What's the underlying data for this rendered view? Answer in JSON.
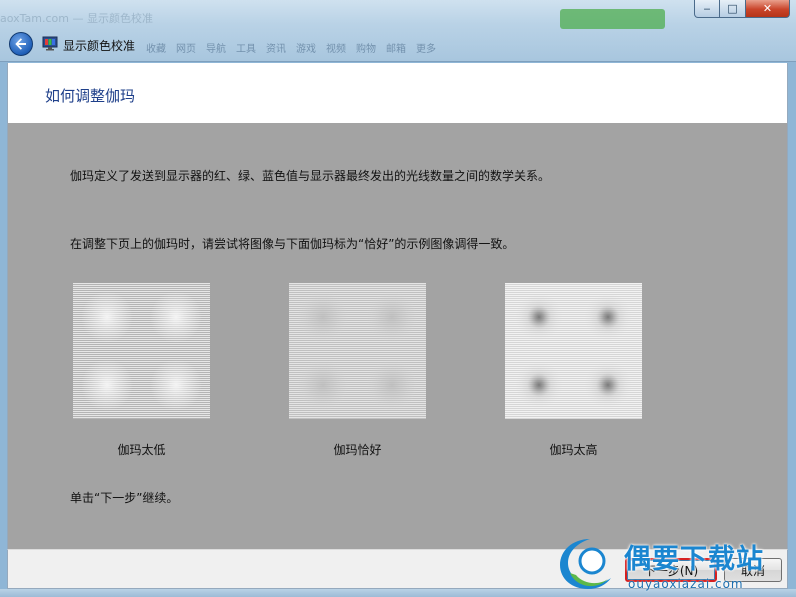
{
  "window": {
    "title": "显示颜色校准",
    "controls": {
      "minimize": "‒",
      "maximize": "□",
      "close": "✕"
    }
  },
  "background_ghost": {
    "url_text": "aoxTam.com — 显示颜色校准",
    "bookmarks": [
      "收藏",
      "网页",
      "导航",
      "工具",
      "资讯",
      "游戏",
      "视频",
      "购物",
      "邮箱",
      "更多"
    ]
  },
  "page": {
    "heading": "如何调整伽玛",
    "para1": "伽玛定义了发送到显示器的红、绿、蓝色值与显示器最终发出的光线数量之间的数学关系。",
    "para2": "在调整下页上的伽玛时，请尝试将图像与下面伽玛标为“恰好”的示例图像调得一致。",
    "para3": "单击“下一步”继续。"
  },
  "samples": [
    {
      "caption": "伽玛太低",
      "dot": "#f4f4f4"
    },
    {
      "caption": "伽玛恰好",
      "dot": "#bdbdbd"
    },
    {
      "caption": "伽玛太高",
      "dot": "#7a7a7a"
    }
  ],
  "footer": {
    "next_label": "下一步(N)",
    "cancel_label": "取消"
  },
  "watermark": {
    "text": "偶要下载站",
    "sub": "ouyaoxiazai.com"
  },
  "colors": {
    "heading": "#1e3f8a",
    "gray_panel": "#a3a3a3",
    "next_highlight": "#d61f1f",
    "watermark": "#1b86d0"
  }
}
